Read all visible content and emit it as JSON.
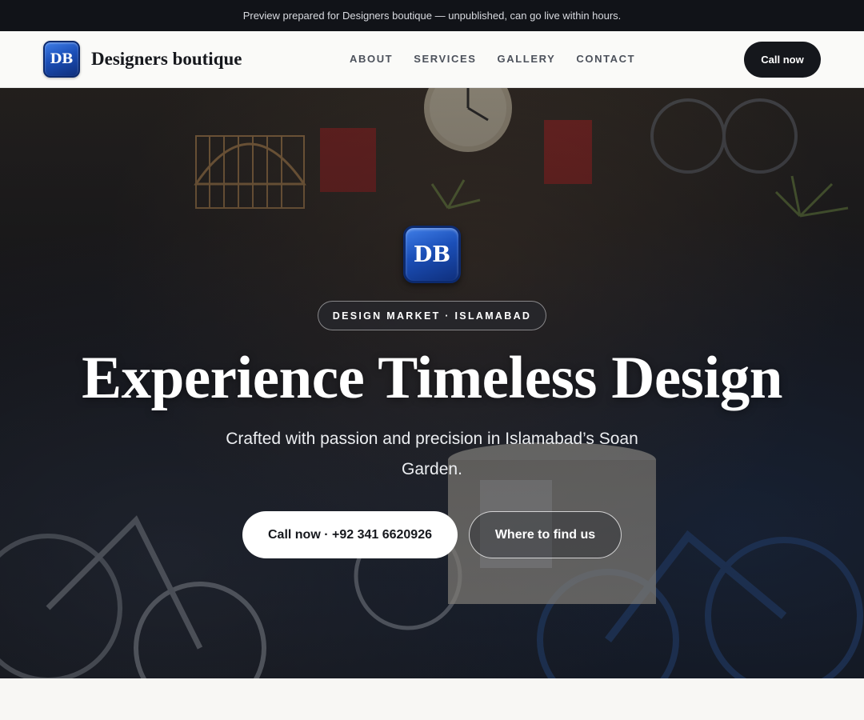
{
  "preview_banner": {
    "text": "Preview prepared for Designers boutique — unpublished, can go live within hours."
  },
  "nav": {
    "logo_initials": "DB",
    "brand_name": "Designers boutique",
    "links": [
      {
        "label": "ABOUT"
      },
      {
        "label": "SERVICES"
      },
      {
        "label": "GALLERY"
      },
      {
        "label": "CONTACT"
      }
    ],
    "cta_label": "Call now"
  },
  "hero": {
    "logo_initials": "DB",
    "tag": "DESIGN MARKET · ISLAMABAD",
    "headline": "Experience Timeless Design",
    "subheadline": "Crafted with passion and precision in Islamabad’s Soan Garden.",
    "primary_button": "Call now · +92 341 6620926",
    "secondary_button": "Where to find us",
    "background_image": "market-stall-photo"
  },
  "colors": {
    "brand_blue": "#1b4fb8",
    "dark": "#15171c",
    "page_bg": "#f8f7f4"
  }
}
